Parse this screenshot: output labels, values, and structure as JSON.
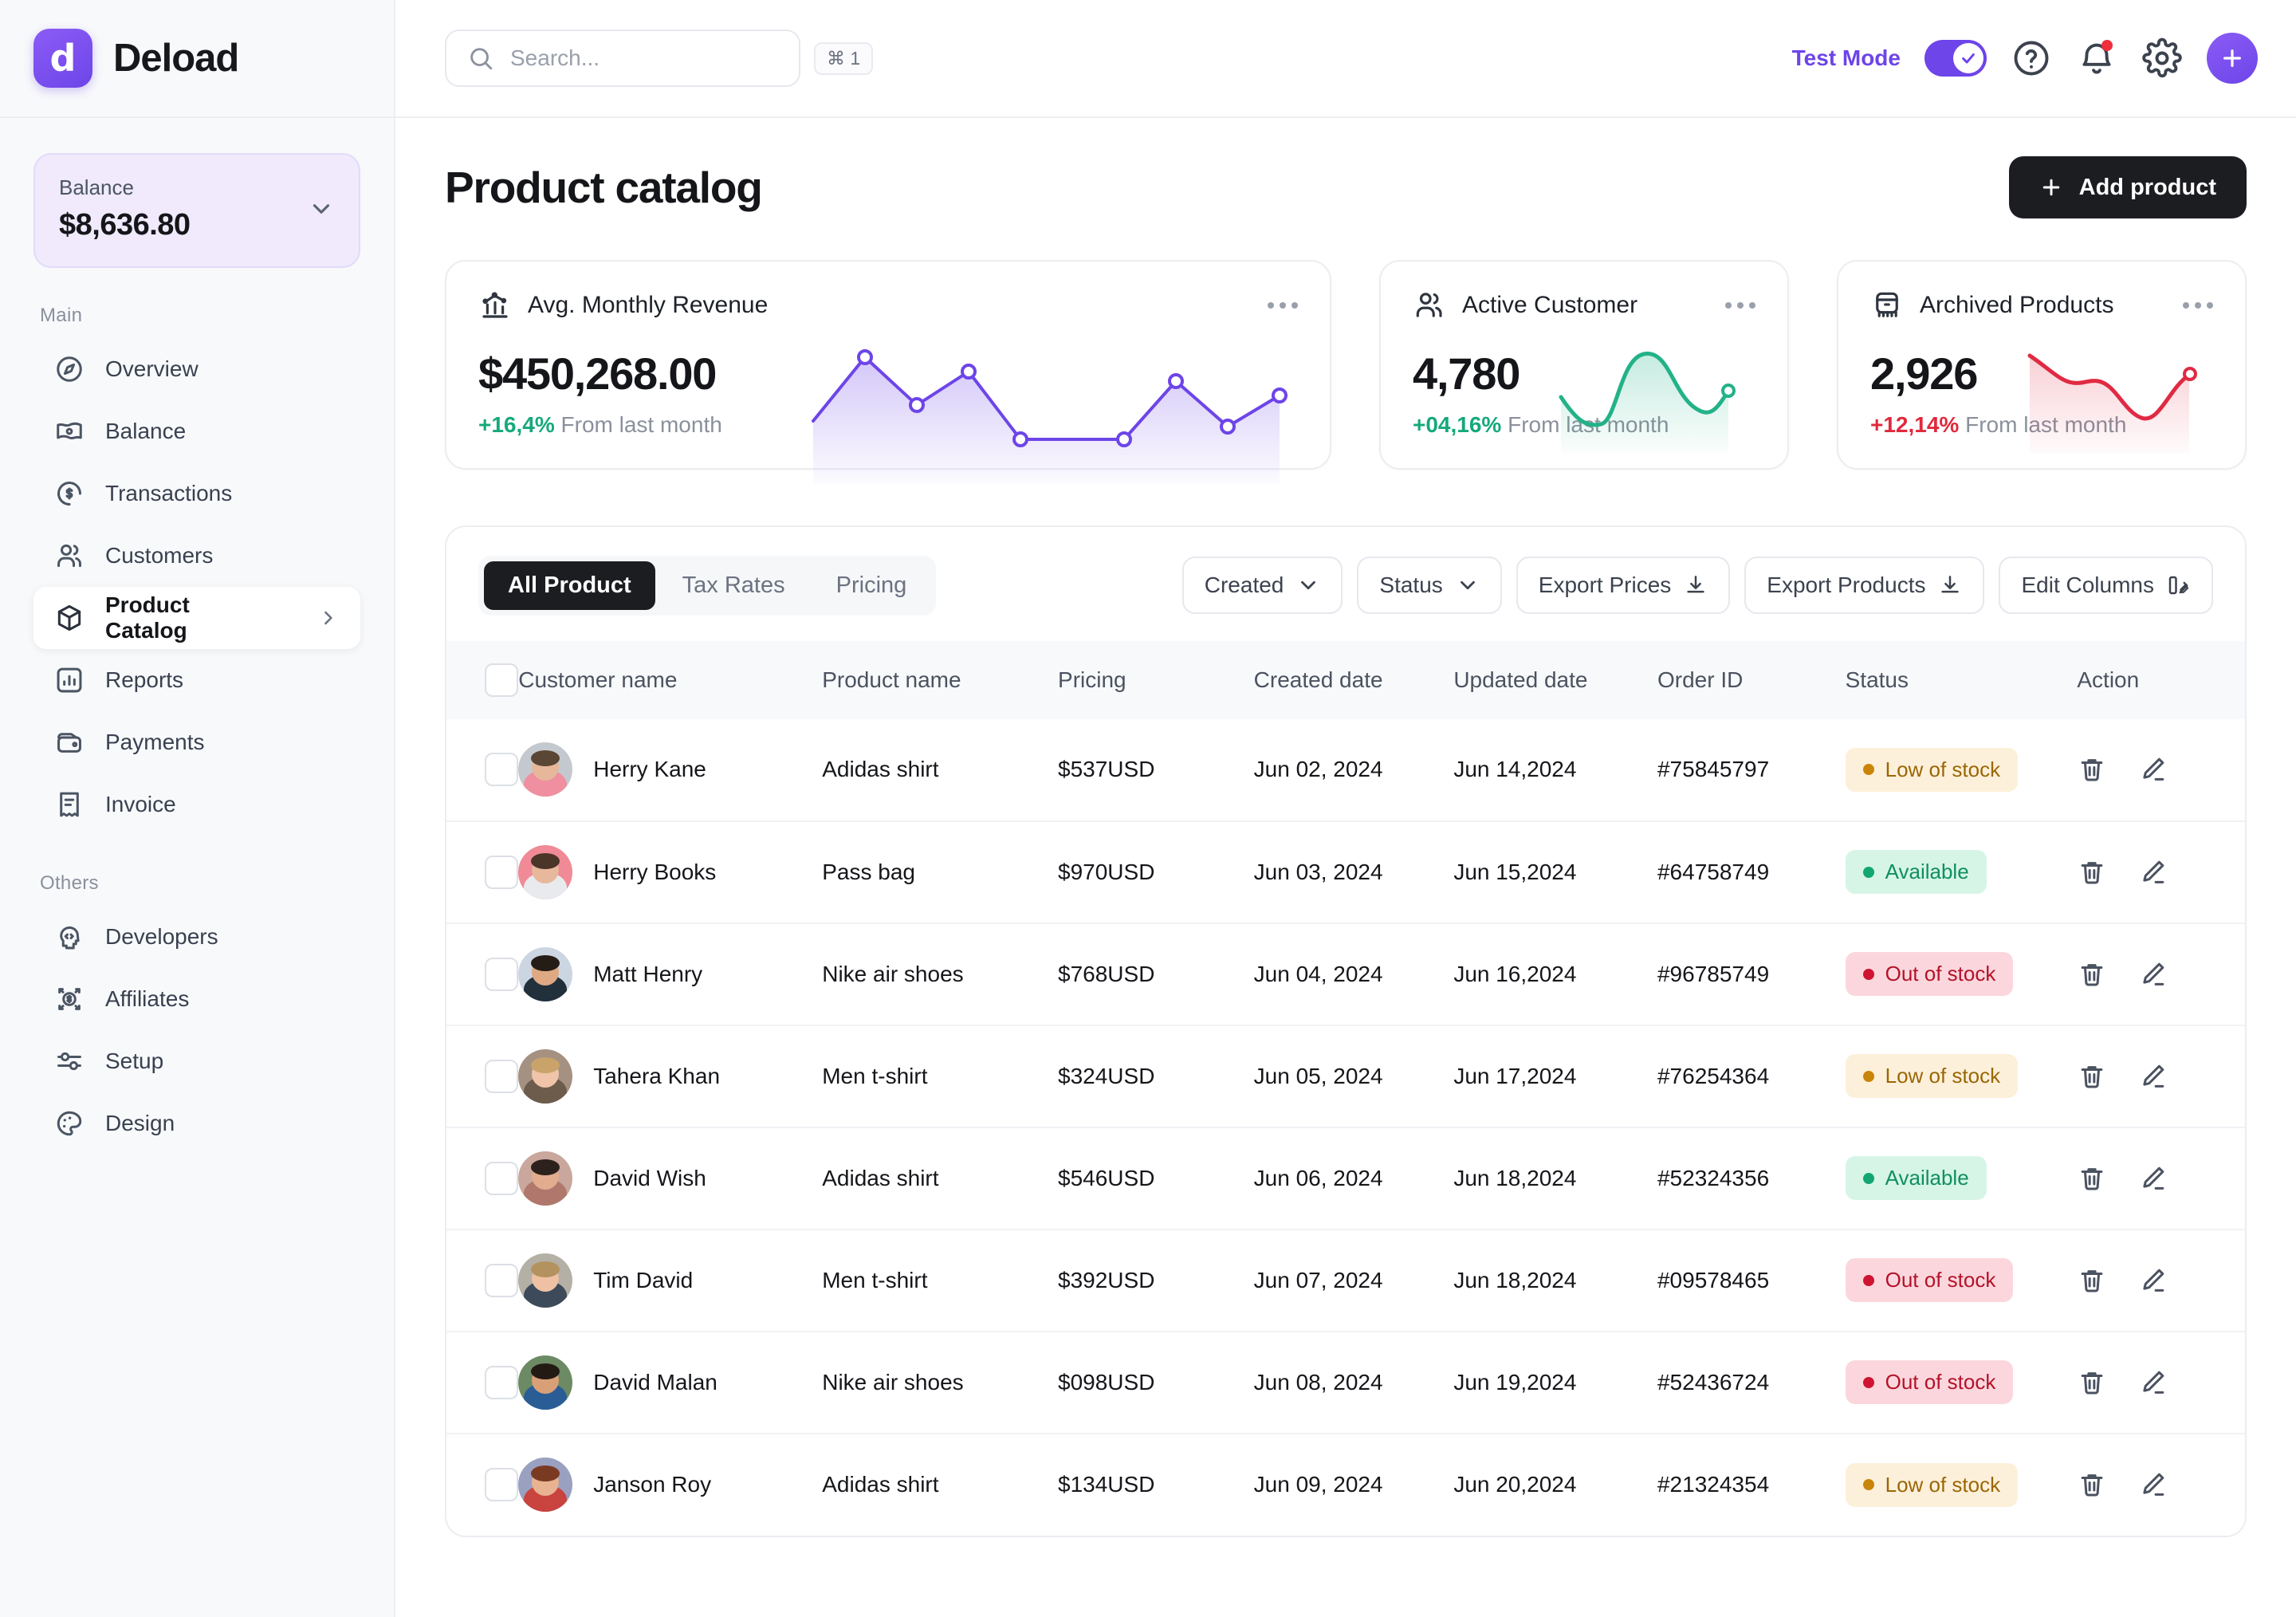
{
  "brand": {
    "name": "Deload",
    "logo_glyph": "d"
  },
  "sidebar": {
    "balance": {
      "label": "Balance",
      "value": "$8,636.80"
    },
    "groups": [
      {
        "label": "Main",
        "items": [
          {
            "label": "Overview",
            "icon": "compass-icon"
          },
          {
            "label": "Balance",
            "icon": "banknote-icon"
          },
          {
            "label": "Transactions",
            "icon": "coin-dollar-icon"
          },
          {
            "label": "Customers",
            "icon": "users-icon"
          },
          {
            "label": "Product Catalog",
            "icon": "cube-icon",
            "active": true,
            "chevron": true
          },
          {
            "label": "Reports",
            "icon": "bar-chart-icon"
          },
          {
            "label": "Payments",
            "icon": "wallet-icon"
          },
          {
            "label": "Invoice",
            "icon": "receipt-icon"
          }
        ]
      },
      {
        "label": "Others",
        "items": [
          {
            "label": "Developers",
            "icon": "code-head-icon"
          },
          {
            "label": "Affiliates",
            "icon": "affiliate-dollar-icon"
          },
          {
            "label": "Setup",
            "icon": "sliders-icon"
          },
          {
            "label": "Design",
            "icon": "palette-icon"
          }
        ]
      }
    ]
  },
  "topbar": {
    "search_placeholder": "Search...",
    "search_value": "",
    "shortcut": "⌘ 1",
    "test_mode_label": "Test Mode",
    "test_mode_on": true,
    "icons": [
      "help-icon",
      "notification-bell-icon",
      "gear-icon",
      "add-icon"
    ]
  },
  "page": {
    "title": "Product catalog",
    "add_button": "Add product"
  },
  "stats": [
    {
      "title": "Avg. Monthly Revenue",
      "icon": "revenue-chart-icon",
      "value": "$450,268.00",
      "delta": "+16,4%",
      "delta_note": "From last month",
      "delta_dir": "up",
      "accent": "#6d45e8"
    },
    {
      "title": "Active Customer",
      "icon": "users-icon",
      "value": "4,780",
      "delta": "+04,16%",
      "delta_note": "From last month",
      "delta_dir": "up",
      "accent": "#23b288"
    },
    {
      "title": "Archived Products",
      "icon": "archive-icon",
      "value": "2,926",
      "delta": "+12,14%",
      "delta_note": "From last month",
      "delta_dir": "up-red",
      "accent": "#e02a43"
    }
  ],
  "chart_data": [
    {
      "type": "line",
      "title": "Avg. Monthly Revenue",
      "x": [
        0,
        1,
        2,
        3,
        4,
        5,
        6,
        7,
        8,
        9
      ],
      "values": [
        42,
        88,
        52,
        78,
        28,
        28,
        28,
        70,
        40,
        40
      ],
      "ylim": [
        0,
        100
      ],
      "grid": false,
      "legend": null,
      "accent": "#6d45e8",
      "markers": true,
      "area_fill": true
    },
    {
      "type": "area",
      "title": "Active Customer",
      "x": [
        0,
        1,
        2,
        3,
        4,
        5,
        6
      ],
      "values": [
        40,
        26,
        30,
        92,
        84,
        52,
        62
      ],
      "ylim": [
        0,
        100
      ],
      "grid": false,
      "legend": null,
      "accent": "#23b288",
      "markers": false,
      "area_fill": true
    },
    {
      "type": "area",
      "title": "Archived Products",
      "x": [
        0,
        1,
        2,
        3,
        4,
        5,
        6
      ],
      "values": [
        84,
        60,
        58,
        40,
        16,
        54,
        80
      ],
      "ylim": [
        0,
        100
      ],
      "grid": false,
      "legend": null,
      "accent": "#e02a43",
      "markers": false,
      "area_fill": true
    }
  ],
  "table_panel": {
    "tabs": [
      {
        "label": "All Product",
        "active": true
      },
      {
        "label": "Tax Rates",
        "active": false
      },
      {
        "label": "Pricing",
        "active": false
      }
    ],
    "tools": [
      {
        "label": "Created",
        "icon": "chevron-down-icon"
      },
      {
        "label": "Status",
        "icon": "chevron-down-icon"
      },
      {
        "label": "Export Prices",
        "icon": "download-icon"
      },
      {
        "label": "Export Products",
        "icon": "download-icon"
      },
      {
        "label": "Edit Columns",
        "icon": "columns-icon"
      }
    ],
    "columns": [
      "Customer name",
      "Product name",
      "Pricing",
      "Created date",
      "Updated date",
      "Order ID",
      "Status",
      "Action"
    ],
    "rows": [
      {
        "name": "Herry Kane",
        "product": "Adidas shirt",
        "price": "$537USD",
        "created": "Jun 02, 2024",
        "updated": "Jun 14,2024",
        "order": "#75845797",
        "status": "Low of stock",
        "status_kind": "low",
        "av_bg": "#c4c9cf",
        "av_hair": "#5a4634",
        "av_skin": "#e6b79a",
        "av_shirt": "#ef8fa0"
      },
      {
        "name": "Herry Books",
        "product": "Pass bag",
        "price": "$970USD",
        "created": "Jun 03, 2024",
        "updated": "Jun 15,2024",
        "order": "#64758749",
        "status": "Available",
        "status_kind": "ok",
        "av_bg": "#f08a96",
        "av_hair": "#4a3528",
        "av_skin": "#e8b89c",
        "av_shirt": "#e9eaee"
      },
      {
        "name": "Matt Henry",
        "product": "Nike air shoes",
        "price": "$768USD",
        "created": "Jun 04, 2024",
        "updated": "Jun 16,2024",
        "order": "#96785749",
        "status": "Out of stock",
        "status_kind": "out",
        "av_bg": "#ccd5e2",
        "av_hair": "#251c16",
        "av_skin": "#dfa983",
        "av_shirt": "#22303c"
      },
      {
        "name": "Tahera Khan",
        "product": "Men t-shirt",
        "price": "$324USD",
        "created": "Jun 05, 2024",
        "updated": "Jun 17,2024",
        "order": "#76254364",
        "status": "Low of stock",
        "status_kind": "low",
        "av_bg": "#a49182",
        "av_hair": "#c9a36a",
        "av_skin": "#efc4a8",
        "av_shirt": "#6d5c4c"
      },
      {
        "name": "David Wish",
        "product": "Adidas shirt",
        "price": "$546USD",
        "created": "Jun 06, 2024",
        "updated": "Jun 18,2024",
        "order": "#52324356",
        "status": "Available",
        "status_kind": "ok",
        "av_bg": "#c9a79c",
        "av_hair": "#2c211c",
        "av_skin": "#e2ac8f",
        "av_shirt": "#b0786c"
      },
      {
        "name": "Tim David",
        "product": "Men t-shirt",
        "price": "$392USD",
        "created": "Jun 07, 2024",
        "updated": "Jun 18,2024",
        "order": "#09578465",
        "status": "Out of stock",
        "status_kind": "out",
        "av_bg": "#b4b0a6",
        "av_hair": "#b4925f",
        "av_skin": "#eec1a4",
        "av_shirt": "#3c4a5a"
      },
      {
        "name": "David Malan",
        "product": "Nike air shoes",
        "price": "$098USD",
        "created": "Jun 08, 2024",
        "updated": "Jun 19,2024",
        "order": "#52436724",
        "status": "Out of stock",
        "status_kind": "out",
        "av_bg": "#6c8a64",
        "av_hair": "#241a14",
        "av_skin": "#d9a078",
        "av_shirt": "#2a5d96"
      },
      {
        "name": "Janson Roy",
        "product": "Adidas shirt",
        "price": "$134USD",
        "created": "Jun 09, 2024",
        "updated": "Jun 20,2024",
        "order": "#21324354",
        "status": "Low of stock",
        "status_kind": "low",
        "av_bg": "#9aa0c0",
        "av_hair": "#7a3a22",
        "av_skin": "#e8b391",
        "av_shirt": "#c9433f"
      }
    ]
  }
}
